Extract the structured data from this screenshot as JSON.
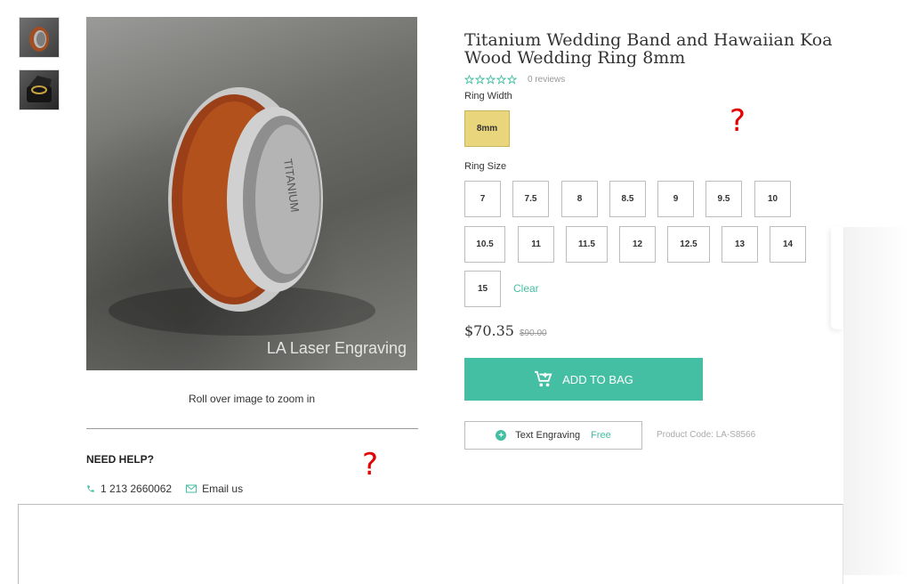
{
  "gallery": {
    "watermark": "LA Laser Engraving",
    "zoom_hint": "Roll over image to zoom in",
    "ring_inscription": "TITANIUM"
  },
  "help": {
    "title": "NEED HELP?",
    "phone": "1 213 2660062",
    "email_label": "Email us"
  },
  "annotations": {
    "question_mark": "?"
  },
  "product": {
    "title": "Titanium Wedding Band and Hawaiian Koa Wood Wedding Ring 8mm",
    "reviews": "0 reviews",
    "rating_stars": 0,
    "ring_width_label": "Ring Width",
    "ring_widths": [
      "8mm"
    ],
    "selected_width": "8mm",
    "ring_size_label": "Ring Size",
    "ring_sizes": [
      "7",
      "7.5",
      "8",
      "8.5",
      "9",
      "9.5",
      "10",
      "10.5",
      "11",
      "11.5",
      "12",
      "12.5",
      "13",
      "14",
      "15"
    ],
    "clear_label": "Clear",
    "price": "$70.35",
    "old_price": "$90.00",
    "add_to_bag": "ADD TO BAG",
    "engraving_label": "Text Engraving",
    "engraving_price": "Free",
    "product_code": "Product Code: LA-S8566"
  },
  "colors": {
    "accent": "#45bfa3",
    "selected_option": "#e9d57c",
    "annotation": "#e40000"
  }
}
